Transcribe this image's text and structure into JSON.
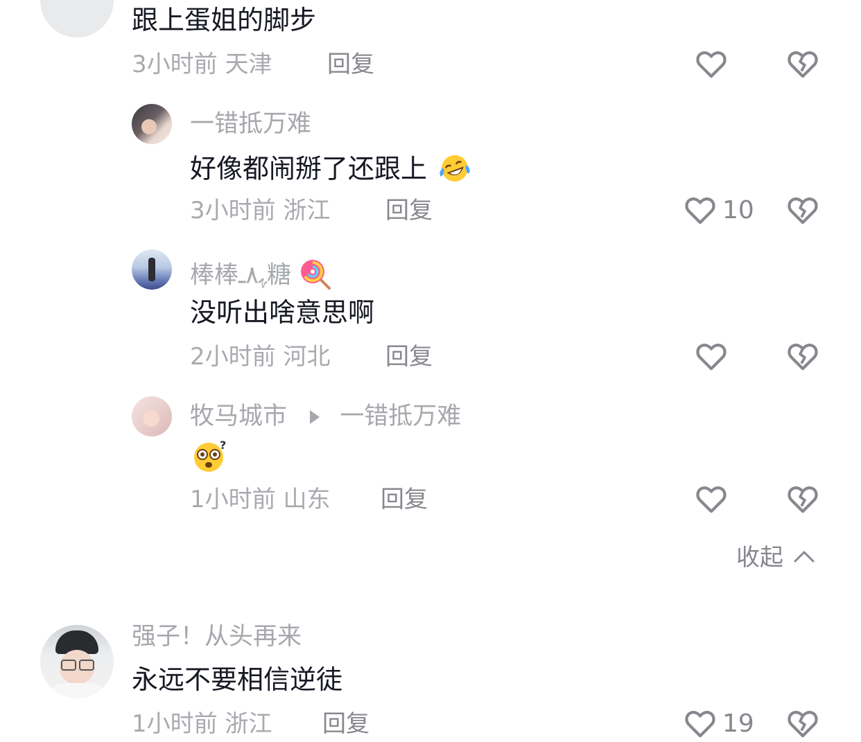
{
  "comments": [
    {
      "text": "跟上蛋姐的脚步",
      "time": "3小时前",
      "location": "天津",
      "reply_label": "回复",
      "likes": ""
    }
  ],
  "replies": [
    {
      "username": "一错抵万难",
      "text": "好像都闹掰了还跟上",
      "emoji": "rolling-on-floor-laughing",
      "time": "3小时前",
      "location": "浙江",
      "reply_label": "回复",
      "likes": "10"
    },
    {
      "username": "棒棒ﮩ٨ـ糖",
      "username_emoji": "lollipop",
      "text": "没听出啥意思啊",
      "time": "2小时前",
      "location": "河北",
      "reply_label": "回复",
      "likes": ""
    },
    {
      "username": "牧马城市",
      "reply_to": "一错抵万难",
      "text": "",
      "emoji": "dizzy-face",
      "time": "1小时前",
      "location": "山东",
      "reply_label": "回复",
      "likes": ""
    }
  ],
  "collapse_label": "收起",
  "comment2": {
    "username": "强子！从头再来",
    "text": "永远不要相信逆徒",
    "time": "1小时前",
    "location": "浙江",
    "reply_label": "回复",
    "likes": "19"
  },
  "colors": {
    "text": "#161823",
    "meta": "#a9aab0",
    "reply": "#86888e",
    "icon": "#86888e"
  }
}
